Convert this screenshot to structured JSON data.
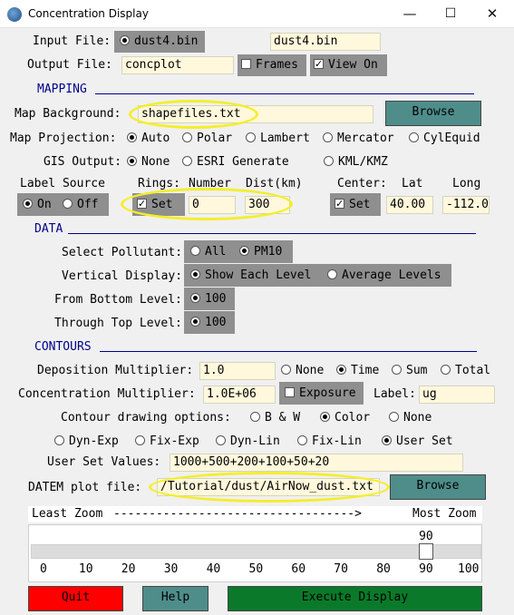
{
  "window": {
    "title": "Concentration Display",
    "minimize": "—",
    "maximize": "☐",
    "close": "✕"
  },
  "io": {
    "input_label": "Input File:",
    "input_option": "dust4.bin",
    "input_value": "dust4.bin",
    "output_label": "Output File:",
    "output_value": "concplot",
    "frames_label": "Frames",
    "frames_checked": false,
    "viewon_label": "View On",
    "viewon_checked": true
  },
  "mapping": {
    "section": "MAPPING",
    "background_label": "Map Background:",
    "background_value": "shapefiles.txt",
    "browse_label": "Browse",
    "projection_label": "Map Projection:",
    "projection_options": [
      "Auto",
      "Polar",
      "Lambert",
      "Mercator",
      "CylEquid"
    ],
    "projection_selected": "Auto",
    "gis_label": "GIS Output:",
    "gis_options": [
      "None",
      "ESRI Generate",
      "KML/KMZ"
    ],
    "gis_selected": "None",
    "label_source_header": "Label Source",
    "label_source_options": [
      "On",
      "Off"
    ],
    "label_source_selected": "On",
    "rings_header": "Rings:",
    "rings_number_header": "Number",
    "rings_dist_header": "Dist(km)",
    "rings_set_label": "Set",
    "rings_set_checked": true,
    "rings_number": "0",
    "rings_dist": "300",
    "center_header": "Center:",
    "center_lat_header": "Lat",
    "center_long_header": "Long",
    "center_set_label": "Set",
    "center_set_checked": true,
    "center_lat": "40.00",
    "center_long": "-112.0"
  },
  "data_section": {
    "section": "DATA",
    "pollutant_label": "Select Pollutant:",
    "pollutant_options": [
      "All",
      "PM10"
    ],
    "pollutant_selected": "PM10",
    "vertical_label": "Vertical Display:",
    "vertical_options": [
      "Show Each Level",
      "Average Levels"
    ],
    "vertical_selected": "Show Each Level",
    "bottom_label": "From Bottom Level:",
    "bottom_value": "100",
    "top_label": "Through Top Level:",
    "top_value": "100"
  },
  "contours": {
    "section": "CONTOURS",
    "deposition_label": "Deposition Multiplier:",
    "deposition_value": "1.0",
    "deposition_options": [
      "None",
      "Time",
      "Sum",
      "Total"
    ],
    "deposition_selected": "Time",
    "concentration_label": "Concentration Multiplier:",
    "concentration_value": "1.0E+06",
    "exposure_label": "Exposure",
    "exposure_checked": false,
    "units_label": "Label:",
    "units_value": "ug",
    "drawing_label": "Contour drawing options:",
    "drawing_options": [
      "B & W",
      "Color",
      "None"
    ],
    "drawing_selected": "Color",
    "type_options": [
      "Dyn-Exp",
      "Fix-Exp",
      "Dyn-Lin",
      "Fix-Lin",
      "User Set"
    ],
    "type_selected": "User Set",
    "user_values_label": "User Set Values:",
    "user_values": "1000+500+200+100+50+20",
    "datem_label": "DATEM plot file:",
    "datem_value": "/Tutorial/dust/AirNow_dust.txt",
    "datem_browse": "Browse"
  },
  "zoom": {
    "least": "Least Zoom",
    "dashes": "---------------------------------->",
    "most": "Most Zoom",
    "value": 90,
    "ticks": [
      "0",
      "10",
      "20",
      "30",
      "40",
      "50",
      "60",
      "70",
      "80",
      "90",
      "100"
    ]
  },
  "buttons": {
    "quit": "Quit",
    "help": "Help",
    "execute": "Execute Display"
  },
  "colors": {
    "panel_gray": "#8f8f8f",
    "field_bg": "#fff8dc",
    "teal_button": "#4f8d8a",
    "quit_red": "#ff0000",
    "execute_green": "#0a7a2a",
    "section_blue": "#00008b",
    "highlight": "#f4ee2c"
  }
}
